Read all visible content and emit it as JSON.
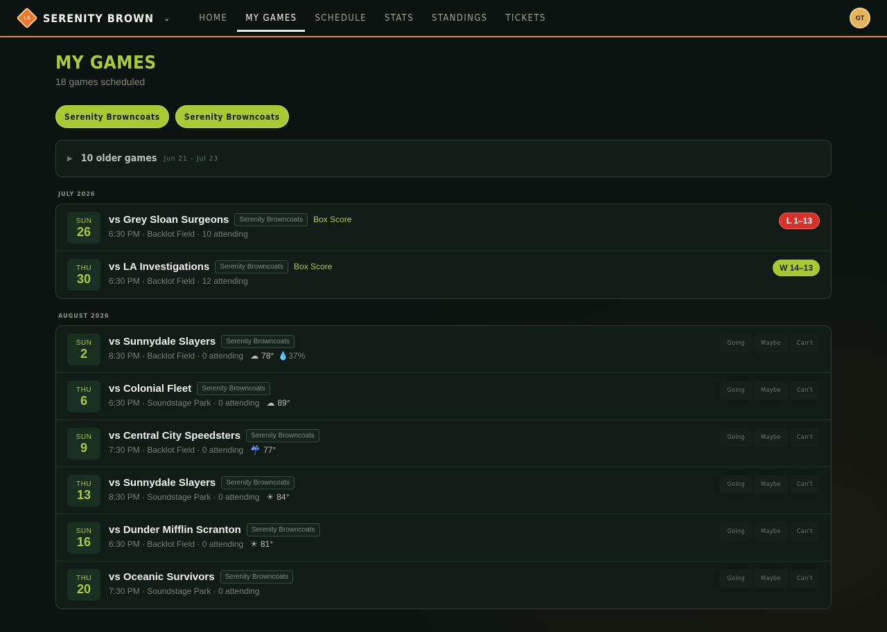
{
  "nav": {
    "logo_text": "LS",
    "team_name": "SERENITY BROWNCOA…",
    "chevron": "⌄",
    "links": [
      {
        "label": "HOME"
      },
      {
        "label": "MY GAMES"
      },
      {
        "label": "SCHEDULE"
      },
      {
        "label": "STATS"
      },
      {
        "label": "STANDINGS"
      },
      {
        "label": "TICKETS"
      }
    ],
    "active_link": "MY GAMES",
    "avatar_initials": "GT"
  },
  "page": {
    "title": "MY GAMES",
    "subtitle": "18 games scheduled"
  },
  "filters": [
    "Serenity Browncoats",
    "Serenity Browncoats"
  ],
  "older": {
    "toggle": "▶",
    "label": "10 older games",
    "range": "Jun 21 – Jul 23"
  },
  "months": [
    {
      "label": "JULY 2026",
      "games": [
        {
          "dow": "SUN",
          "day": "26",
          "opponent": "vs Grey Sloan Surgeons",
          "team": "Serenity Browncoats",
          "box_score": "Box Score",
          "details": "6:30 PM · Backlot Field · 10 attending",
          "result": "L 1–13",
          "result_type": "loss"
        },
        {
          "dow": "THU",
          "day": "30",
          "opponent": "vs LA Investigations",
          "team": "Serenity Browncoats",
          "box_score": "Box Score",
          "details": "6:30 PM · Backlot Field · 12 attending",
          "result": "W 14–13",
          "result_type": "win"
        }
      ]
    },
    {
      "label": "AUGUST 2026",
      "games": [
        {
          "dow": "SUN",
          "day": "2",
          "opponent": "vs Sunnydale Slayers",
          "team": "Serenity Browncoats",
          "details": "8:30 PM · Backlot Field · 0 attending",
          "weather_icon": "☁",
          "temp": "78°",
          "rain_icon": "💧",
          "rain": "37%",
          "rsvp": [
            "Going",
            "Maybe",
            "Can't"
          ]
        },
        {
          "dow": "THU",
          "day": "6",
          "opponent": "vs Colonial Fleet",
          "team": "Serenity Browncoats",
          "details": "6:30 PM · Soundstage Park · 0 attending",
          "weather_icon": "☁",
          "temp": "89°",
          "rsvp": [
            "Going",
            "Maybe",
            "Can't"
          ]
        },
        {
          "dow": "SUN",
          "day": "9",
          "opponent": "vs Central City Speedsters",
          "team": "Serenity Browncoats",
          "details": "7:30 PM · Backlot Field · 0 attending",
          "weather_icon": "☔",
          "temp": "77°",
          "rsvp": [
            "Going",
            "Maybe",
            "Can't"
          ]
        },
        {
          "dow": "THU",
          "day": "13",
          "opponent": "vs Sunnydale Slayers",
          "team": "Serenity Browncoats",
          "details": "8:30 PM · Soundstage Park · 0 attending",
          "weather_icon": "☀",
          "temp": "84°",
          "rsvp": [
            "Going",
            "Maybe",
            "Can't"
          ]
        },
        {
          "dow": "SUN",
          "day": "16",
          "opponent": "vs Dunder Mifflin Scranton",
          "team": "Serenity Browncoats",
          "details": "6:30 PM · Backlot Field · 0 attending",
          "weather_icon": "☀",
          "temp": "81°",
          "rsvp": [
            "Going",
            "Maybe",
            "Can't"
          ]
        },
        {
          "dow": "THU",
          "day": "20",
          "opponent": "vs Oceanic Survivors",
          "team": "Serenity Browncoats",
          "details": "7:30 PM · Soundstage Park · 0 attending",
          "rsvp": [
            "Going",
            "Maybe",
            "Can't"
          ]
        }
      ]
    }
  ]
}
